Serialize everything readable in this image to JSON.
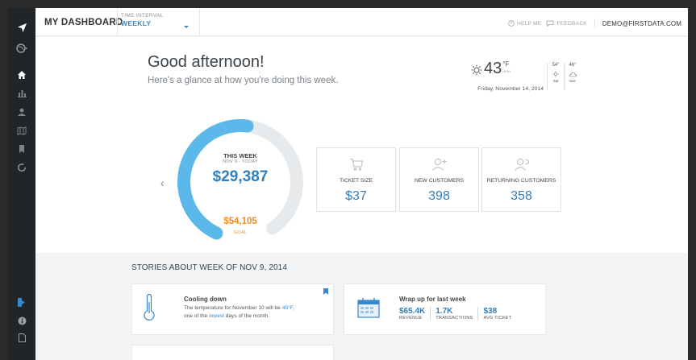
{
  "topbar": {
    "title": "MY DASHBOARD",
    "interval_label": "TIME INTERVAL",
    "interval_value": "WEEKLY",
    "help": "HELP ME",
    "feedback": "FEEDBACK",
    "email": "DEMO@FIRSTDATA.COM"
  },
  "rail": {
    "icons": [
      "send-icon",
      "globe-icon",
      "home-icon",
      "bar-chart-icon",
      "users-icon",
      "map-icon",
      "bookmark-icon",
      "refresh-icon",
      "logout-icon",
      "info-icon",
      "document-icon"
    ],
    "active": "home-icon"
  },
  "greeting": {
    "title": "Good afternoon!",
    "subtitle": "Here's a glance at how you're doing this week."
  },
  "weather": {
    "temp": "43",
    "unit": "°F",
    "unit_sub": "HIGH",
    "date": "Friday, November 14, 2014",
    "forecast": [
      {
        "temp": "54°",
        "day": "Sat",
        "icon": "sun-icon"
      },
      {
        "temp": "46°",
        "day": "Sun",
        "icon": "cloud-icon"
      }
    ]
  },
  "gauge": {
    "label": "THIS WEEK",
    "range": "NOV 9 - TODAY",
    "value": "$29,387",
    "goal": "$54,105",
    "goal_label": "GOAL",
    "progress": 0.54
  },
  "kpis": [
    {
      "label": "TICKET SIZE",
      "value": "$37",
      "icon": "cart-icon"
    },
    {
      "label": "NEW CUSTOMERS",
      "value": "398",
      "icon": "add-user-icon"
    },
    {
      "label": "RETURNING CUSTOMERS",
      "value": "358",
      "icon": "returning-user-icon"
    }
  ],
  "stories": {
    "title": "STORIES ABOUT WEEK OF NOV 9, 2014",
    "cards": [
      {
        "title": "Cooling down",
        "text_1": "The temperature for November 10 will be ",
        "text_hl1": "45°F",
        "text_2": ",",
        "text_3": "one of the ",
        "text_hl2": "lowest",
        "text_4": " days of the month."
      },
      {
        "title": "Wrap up for last week",
        "metrics": [
          {
            "value": "$65.4K",
            "label": "REVENUE"
          },
          {
            "value": "1.7K",
            "label": "TRANSACTIONS"
          },
          {
            "value": "$38",
            "label": "AVG TICKET"
          }
        ]
      }
    ]
  },
  "colors": {
    "accent": "#3a86c8",
    "gauge_fill": "#5bb8ea",
    "gauge_track": "#e7eaed",
    "goal": "#f28c1e",
    "rail": "#212528"
  }
}
